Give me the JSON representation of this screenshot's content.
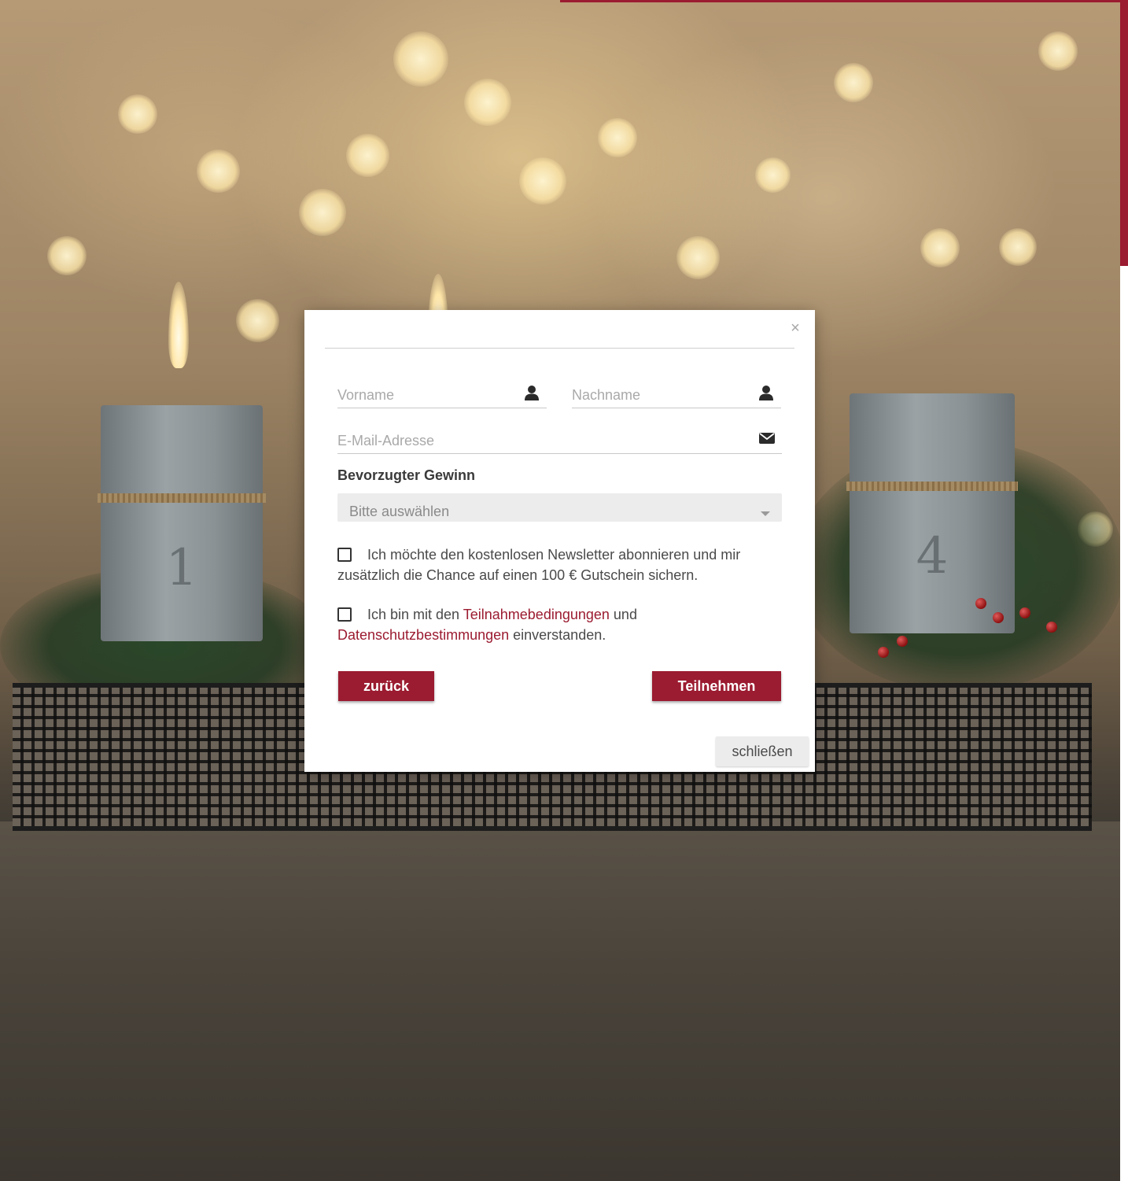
{
  "modal": {
    "close_symbol": "×",
    "fields": {
      "first_name_placeholder": "Vorname",
      "last_name_placeholder": "Nachname",
      "email_placeholder": "E-Mail-Adresse"
    },
    "prize_label": "Bevorzugter Gewinn",
    "prize_select_value": "Bitte auswählen",
    "newsletter_text": "Ich möchte den kostenlosen Newsletter abonnieren und mir zusätzlich die Chance auf einen 100 € Gutschein sichern.",
    "terms": {
      "prefix": "Ich bin mit den",
      "terms_link": "Teilnahmebedingungen",
      "middle": "und",
      "privacy_link": "Datenschutzbestimmungen",
      "suffix": "einverstanden."
    },
    "back_button": "zurück",
    "submit_button": "Teilnehmen",
    "close_button": "schließen"
  },
  "background": {
    "candle_left_number": "1",
    "candle_right_number": "4"
  },
  "icons": {
    "first_name": "user-icon",
    "last_name": "user-icon",
    "email": "envelope-icon",
    "select": "caret-down-icon",
    "close": "close-icon"
  },
  "colors": {
    "accent": "#9b1b30",
    "select_bg": "#ececec",
    "close_button_bg": "#ececec"
  }
}
